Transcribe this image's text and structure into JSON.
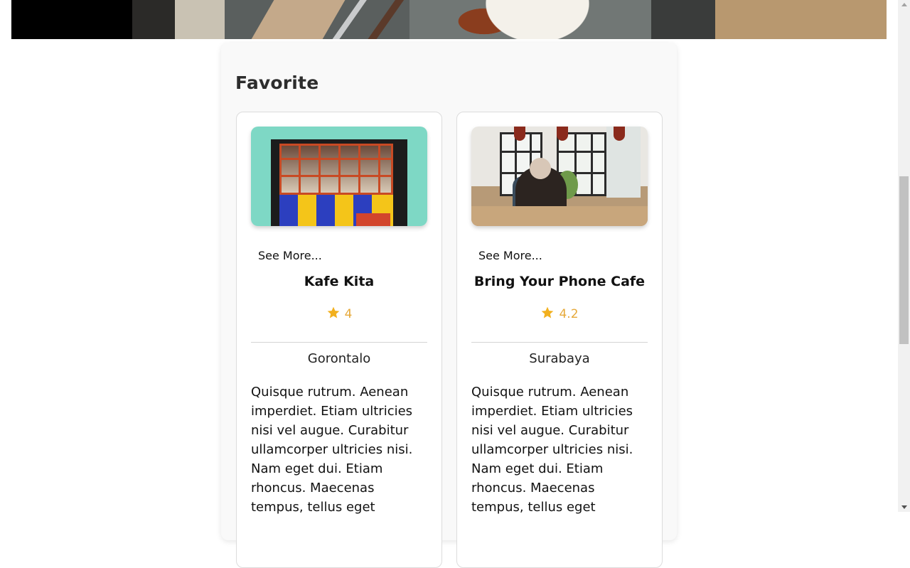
{
  "section": {
    "title": "Favorite"
  },
  "cards": [
    {
      "see_more": "See More...",
      "name": "Kafe Kita",
      "rating": "4",
      "city": "Gorontalo",
      "description": "Quisque rutrum. Aenean imperdiet. Etiam ultricies nisi vel augue. Curabitur ullamcorper ultricies nisi. Nam eget dui. Etiam rhoncus. Maecenas tempus, tellus eget"
    },
    {
      "see_more": "See More...",
      "name": "Bring Your Phone Cafe",
      "rating": "4.2",
      "city": "Surabaya",
      "description": "Quisque rutrum. Aenean imperdiet. Etiam ultricies nisi vel augue. Curabitur ullamcorper ultricies nisi. Nam eget dui. Etiam rhoncus. Maecenas tempus, tellus eget"
    }
  ],
  "icons": {
    "rating": "star-icon"
  },
  "colors": {
    "rating": "#e6a93a",
    "star": "#f2b01e"
  }
}
